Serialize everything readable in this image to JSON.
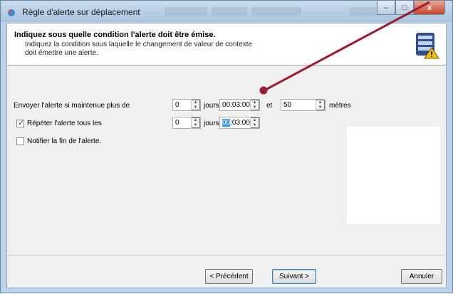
{
  "window": {
    "title": "Règle d'alerte sur déplacement",
    "controls": {
      "minimize": "–",
      "maximize": "□",
      "close": "x"
    }
  },
  "header": {
    "title": "Indiquez sous quelle condition l'alerte doit être émise.",
    "description": "Indiquez la condition sous laquelle le changement de valeur de contexte doit émettre une alerte.",
    "icon": "database-alert-icon"
  },
  "conditions": {
    "row1": {
      "label": "Envoyer l'alerte si maintenue plus de",
      "days_value": "0",
      "days_unit": "jours",
      "time_value": "00:03:00",
      "conjunction": "et",
      "distance_value": "50",
      "distance_unit": "mètres"
    },
    "row2": {
      "checkbox_checked": true,
      "label": "Répéter l'alerte tous les",
      "days_value": "0",
      "days_unit": "jours",
      "time_selected": "00",
      "time_rest": ":03:00"
    },
    "row3": {
      "checkbox_checked": false,
      "label": "Notifier la fin de l'alerte."
    }
  },
  "footer": {
    "back_label": "< Précédent",
    "next_label": "Suivant >",
    "cancel_label": "Annuler"
  },
  "colors": {
    "annotation_arrow": "#9b1b30",
    "selection": "#3399ff",
    "title_bar": "#bcd2e8"
  }
}
